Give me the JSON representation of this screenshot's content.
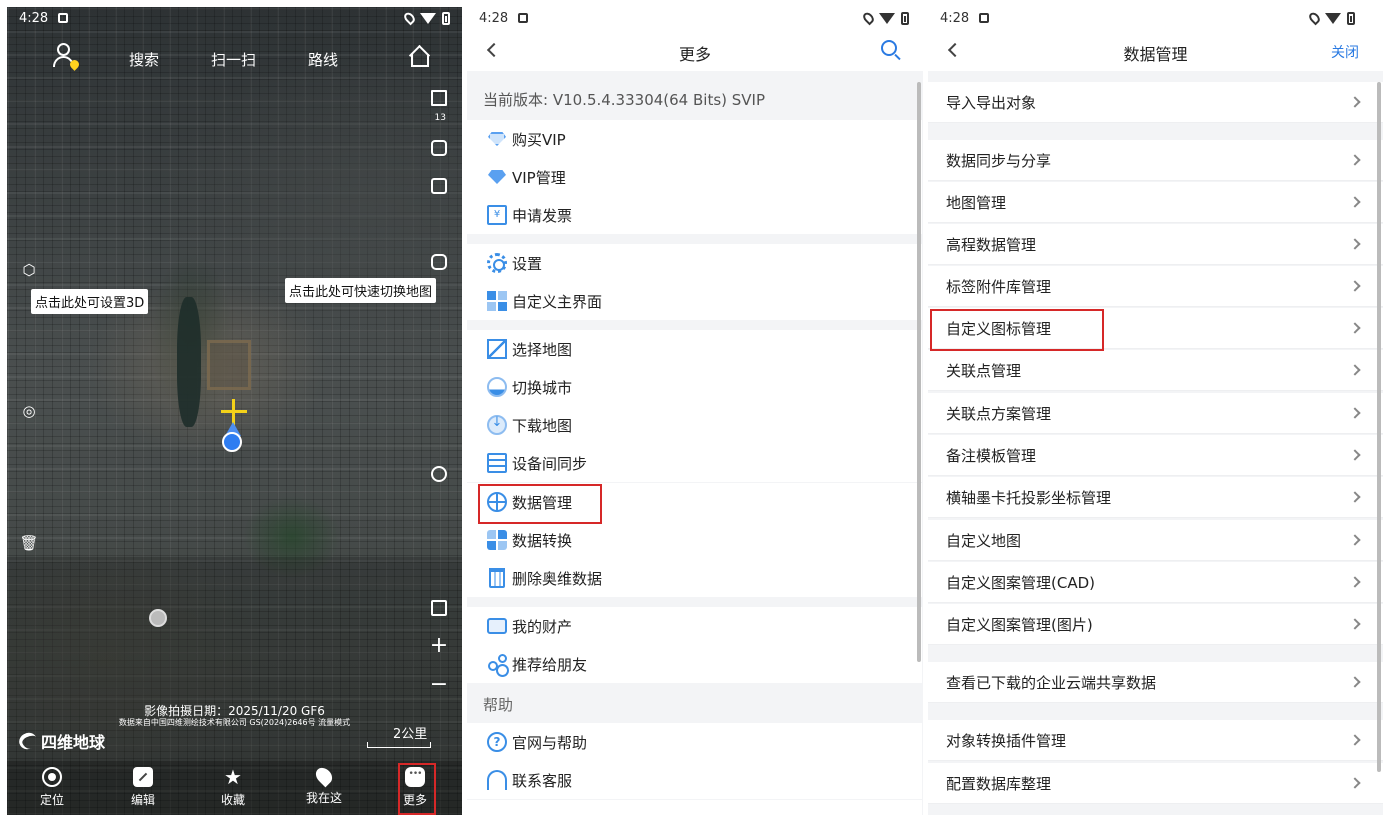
{
  "status": {
    "time": "4:28"
  },
  "map": {
    "top_nav": {
      "search": "搜索",
      "scan": "扫一扫",
      "route": "路线"
    },
    "zoom_level": "13",
    "hint_3d": "点击此处可设置3D",
    "hint_switch_map": "点击此处可快速切换地图",
    "capture_date": "影像拍摄日期：2025/11/20 GF6",
    "copyright": "数据来自中国四维测绘技术有限公司 GS(2024)2646号 流量模式",
    "brand": "四维地球",
    "scale": "2公里",
    "bottom_nav": [
      {
        "label": "定位"
      },
      {
        "label": "编辑"
      },
      {
        "label": "收藏"
      },
      {
        "label": "我在这"
      },
      {
        "label": "更多"
      }
    ]
  },
  "more": {
    "title": "更多",
    "version": "当前版本: V10.5.4.33304(64 Bits) SVIP",
    "items": [
      {
        "label": "购买VIP"
      },
      {
        "label": "VIP管理"
      },
      {
        "label": "申请发票"
      },
      {
        "label": "设置"
      },
      {
        "label": "自定义主界面"
      },
      {
        "label": "选择地图"
      },
      {
        "label": "切换城市"
      },
      {
        "label": "下载地图"
      },
      {
        "label": "设备间同步"
      },
      {
        "label": "数据管理"
      },
      {
        "label": "数据转换"
      },
      {
        "label": "删除奥维数据"
      },
      {
        "label": "我的财产"
      },
      {
        "label": "推荐给朋友"
      },
      {
        "label": "官网与帮助"
      },
      {
        "label": "联系客服"
      }
    ],
    "section_help": "帮助"
  },
  "data_mgmt": {
    "title": "数据管理",
    "close": "关闭",
    "items": [
      {
        "label": "导入导出对象"
      },
      {
        "label": "数据同步与分享"
      },
      {
        "label": "地图管理"
      },
      {
        "label": "高程数据管理"
      },
      {
        "label": "标签附件库管理"
      },
      {
        "label": "自定义图标管理"
      },
      {
        "label": "关联点管理"
      },
      {
        "label": "关联点方案管理"
      },
      {
        "label": "备注模板管理"
      },
      {
        "label": "横轴墨卡托投影坐标管理"
      },
      {
        "label": "自定义地图"
      },
      {
        "label": "自定义图案管理(CAD)"
      },
      {
        "label": "自定义图案管理(图片)"
      },
      {
        "label": "查看已下载的企业云端共享数据"
      },
      {
        "label": "对象转换插件管理"
      },
      {
        "label": "配置数据库整理"
      }
    ]
  }
}
